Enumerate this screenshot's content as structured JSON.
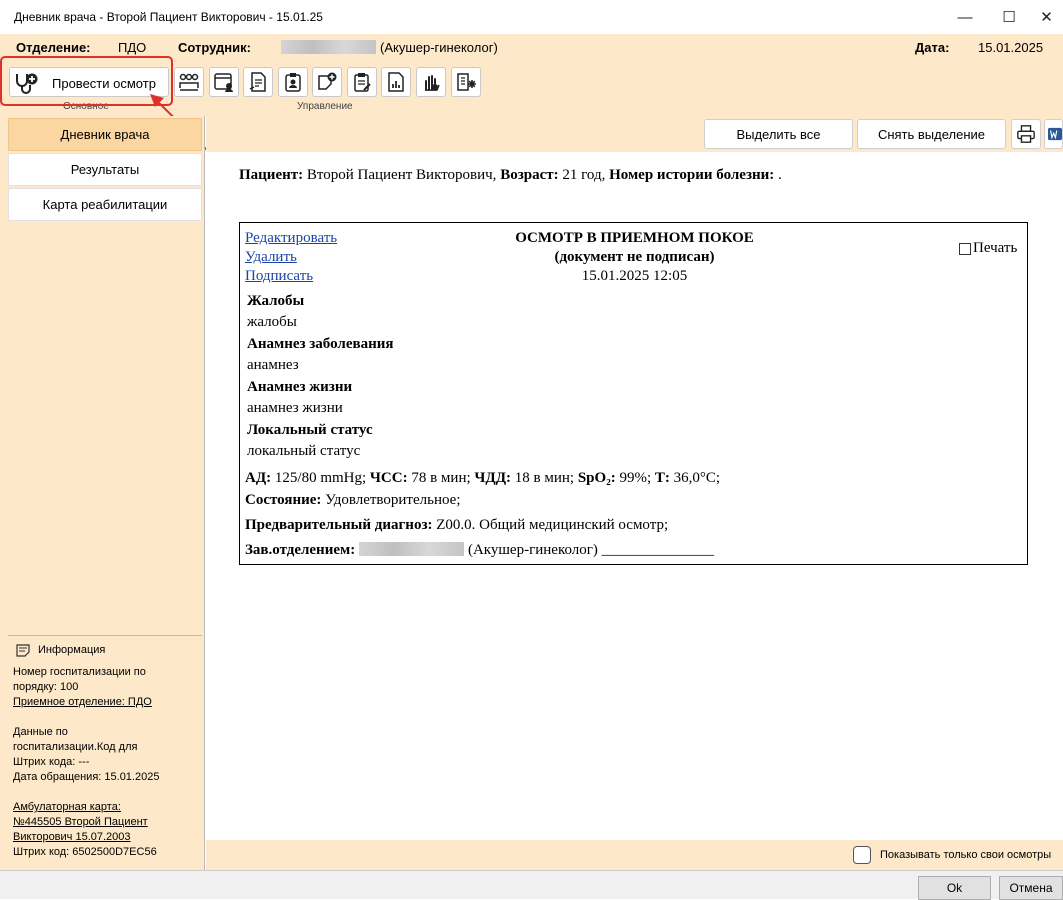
{
  "window": {
    "title": "Дневник врача - Второй Пациент Викторович - 15.01.25",
    "minimize": "—",
    "maximize": "☐",
    "close": "✕"
  },
  "header": {
    "department_label": "Отделение:",
    "department_value": "ПДО",
    "employee_label": "Сотрудник:",
    "employee_role": "(Акушер-гинеколог)",
    "date_label": "Дата:",
    "date_value": "15.01.2025"
  },
  "ribbon": {
    "main_button_label": "Провести осмотр",
    "group_main_label": "Основное",
    "group_manage_label": "Управление",
    "tool_icons": [
      "group-icon",
      "patient-card-icon",
      "document-sign-icon",
      "badge-icon",
      "note-add-icon",
      "clipboard-icon",
      "report-chart-icon",
      "hand-icon",
      "list-settings-icon"
    ]
  },
  "nav": {
    "items": [
      "Дневник врача",
      "Результаты",
      "Карта реабилитации"
    ],
    "active_index": 0
  },
  "info": {
    "heading": "Информация",
    "hosp_number": "Номер госпитализации по порядку: 100",
    "admission_dept": "Приемное отделение: ПДО",
    "hosp_data": "Данные по госпитализации.Код для",
    "barcode_line": "Штрих кода: ---",
    "visit_date": "Дата обращения: 15.01.2025",
    "outpatient_card": "Амбулаторная карта: №445505 Второй Пациент Викторович 15.07.2003",
    "barcode": "Штрих код: 6502500D7EC56"
  },
  "toolbar": {
    "select_all": "Выделить все",
    "deselect": "Снять выделение"
  },
  "patient_line": {
    "patient_label": "Пациент:",
    "patient_name": "Второй Пациент Викторович,",
    "age_label": "Возраст:",
    "age_value": "21 год,",
    "history_label": "Номер истории болезни:",
    "history_value": "."
  },
  "document": {
    "edit_link": "Редактировать",
    "delete_link": "Удалить",
    "sign_link": "Подписать",
    "title": "ОСМОТР В ПРИЕМНОМ ПОКОЕ",
    "subtitle": "(документ не подписан)",
    "datetime": "15.01.2025 12:05",
    "print_label": "Печать",
    "sections": [
      {
        "heading": "Жалобы",
        "text": "жалобы"
      },
      {
        "heading": "Анамнез заболевания",
        "text": "анамнез"
      },
      {
        "heading": "Анамнез жизни",
        "text": "анамнез жизни"
      },
      {
        "heading": "Локальный статус",
        "text": "локальный статус"
      }
    ],
    "vitals": {
      "ad_label": "АД:",
      "ad_value": "125/80 mmHg;",
      "hr_label": "ЧСС:",
      "hr_value": "78 в мин;",
      "rr_label": "ЧДД:",
      "rr_value": "18 в мин;",
      "spo2_label": "SpO₂:",
      "spo2_value": "99%;",
      "t_label": "Т:",
      "t_value": "36,0°C;"
    },
    "condition_label": "Состояние:",
    "condition_value": "Удовлетворительное;",
    "diagnosis_label": "Предварительный диагноз:",
    "diagnosis_value": "Z00.0. Общий медицинский осмотр;",
    "head_label": "Зав.отделением:",
    "head_role": "(Акушер-гинеколог) _______________"
  },
  "footer": {
    "own_only_label": "Показывать только свои осмотры"
  },
  "dialog": {
    "ok": "Ok",
    "cancel": "Отмена"
  },
  "colors": {
    "panel_bg": "#fde8c9",
    "active_nav": "#fcd6a1",
    "highlight": "#e0302a",
    "link": "#1a44a8"
  }
}
